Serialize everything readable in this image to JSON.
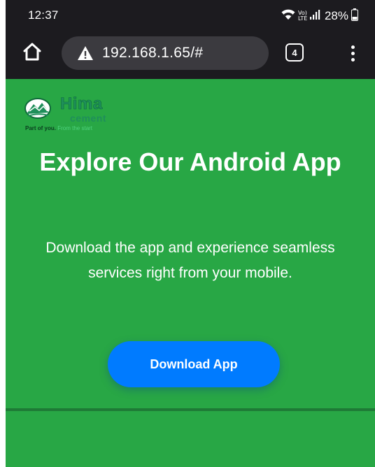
{
  "status_bar": {
    "time": "12:37",
    "network_label": "Vo) LTE",
    "battery": "28%"
  },
  "browser": {
    "url": "192.168.1.65/#",
    "tab_count": "4"
  },
  "logo": {
    "name": "Hima",
    "sub": "cement",
    "tagline_strong": "Part of you.",
    "tagline_light": " From the start"
  },
  "hero": {
    "title": "Explore Our Android App",
    "description": "Download the app and experience seamless services right from your mobile.",
    "button_label": "Download App"
  },
  "colors": {
    "page_background": "#28a745",
    "button": "#007bff",
    "chrome": "#1c1b1f",
    "url_bar": "#3b3a3f"
  },
  "icons": {
    "home": "home-icon",
    "warning": "warning-icon",
    "tabs": "tabs-icon",
    "menu": "more-vert-icon",
    "wifi": "wifi-icon",
    "signal": "signal-icon",
    "battery": "battery-icon"
  }
}
